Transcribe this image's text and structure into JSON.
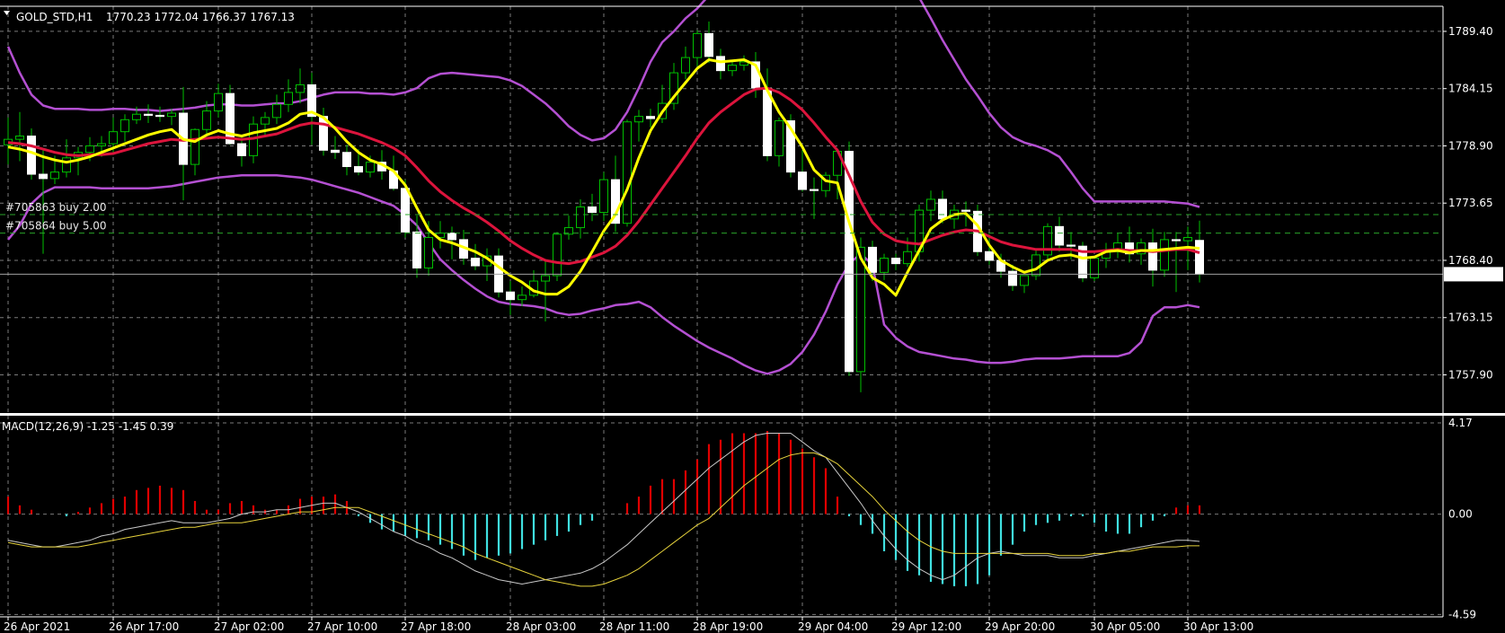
{
  "window": {
    "symbol_header": "GOLD_STD,H1",
    "ohlc_header": "1770.23 1772.04 1766.37 1767.13",
    "colors": {
      "background": "#000000",
      "grid": "#7a7a7a",
      "candle_bull": "#000000",
      "candle_bear": "#ffffff",
      "wick": "#00c000",
      "ma_fast": "#ffff00",
      "ma_slow": "#dc143c",
      "bollinger": "#b450d2",
      "histogram_pos": "#e00000",
      "histogram_neg": "#40e0e0",
      "macd_line": "#c8c8c8",
      "signal_line": "#e6d23c"
    }
  },
  "orders": [
    {
      "label": "#705863 buy 2.00",
      "price": 1772.6
    },
    {
      "label": "#705864 buy 5.00",
      "price": 1770.9
    }
  ],
  "current_price": {
    "label": "1767.13",
    "value": 1767.13
  },
  "price_axis": {
    "ticks": [
      "1789.40",
      "1784.15",
      "1778.90",
      "1773.65",
      "1768.40",
      "1763.15",
      "1757.90"
    ],
    "values": [
      1789.4,
      1784.15,
      1778.9,
      1773.65,
      1768.4,
      1763.15,
      1757.9
    ],
    "range": [
      1754.4,
      1791.7
    ]
  },
  "time_axis": {
    "labels": [
      "26 Apr 2021",
      "26 Apr 17:00",
      "27 Apr 02:00",
      "27 Apr 10:00",
      "27 Apr 18:00",
      "28 Apr 03:00",
      "28 Apr 11:00",
      "28 Apr 19:00",
      "29 Apr 04:00",
      "29 Apr 12:00",
      "29 Apr 20:00",
      "30 Apr 05:00",
      "30 Apr 13:00"
    ],
    "bar_index": [
      0,
      9,
      18,
      26,
      34,
      43,
      51,
      59,
      68,
      76,
      84,
      93,
      101
    ]
  },
  "macd": {
    "title": "MACD(12,26,9) -1.25 -1.45 0.39",
    "ticks": [
      "4.17",
      "0.00",
      "-4.59"
    ],
    "tick_values": [
      4.17,
      0,
      -4.59
    ],
    "range": [
      -4.7,
      4.5
    ]
  },
  "chart_data": {
    "type": "candlestick",
    "title": "GOLD_STD,H1",
    "bars": 103,
    "ohlc": [
      [
        1779.0,
        1781.5,
        1777.2,
        1779.5
      ],
      [
        1779.5,
        1782.0,
        1777.5,
        1779.8
      ],
      [
        1779.8,
        1780.5,
        1775.8,
        1776.3
      ],
      [
        1776.3,
        1778.5,
        1769.0,
        1775.9
      ],
      [
        1775.9,
        1778.0,
        1775.4,
        1776.5
      ],
      [
        1776.5,
        1779.5,
        1776.0,
        1777.8
      ],
      [
        1777.8,
        1778.8,
        1776.2,
        1778.3
      ],
      [
        1778.3,
        1779.7,
        1777.5,
        1778.9
      ],
      [
        1778.9,
        1779.8,
        1777.9,
        1779.1
      ],
      [
        1779.1,
        1781.5,
        1778.3,
        1780.2
      ],
      [
        1780.2,
        1781.8,
        1779.3,
        1781.3
      ],
      [
        1781.3,
        1782.5,
        1780.9,
        1781.8
      ],
      [
        1781.8,
        1782.7,
        1781.0,
        1781.7
      ],
      [
        1781.7,
        1782.5,
        1781.1,
        1781.6
      ],
      [
        1781.6,
        1782.3,
        1780.8,
        1781.9
      ],
      [
        1781.9,
        1784.3,
        1773.9,
        1777.2
      ],
      [
        1777.2,
        1780.5,
        1776.2,
        1780.4
      ],
      [
        1780.4,
        1783.0,
        1780.0,
        1782.1
      ],
      [
        1782.1,
        1784.6,
        1781.5,
        1783.7
      ],
      [
        1783.7,
        1784.5,
        1779.0,
        1779.1
      ],
      [
        1779.1,
        1779.8,
        1777.0,
        1778.0
      ],
      [
        1778.0,
        1781.6,
        1777.3,
        1780.9
      ],
      [
        1780.9,
        1782.0,
        1779.8,
        1781.5
      ],
      [
        1781.5,
        1783.6,
        1780.9,
        1782.7
      ],
      [
        1782.7,
        1785.0,
        1782.0,
        1783.8
      ],
      [
        1783.8,
        1786.0,
        1782.8,
        1784.5
      ],
      [
        1784.5,
        1785.6,
        1779.0,
        1781.6
      ],
      [
        1781.6,
        1782.4,
        1778.0,
        1778.5
      ],
      [
        1778.5,
        1779.8,
        1777.7,
        1778.3
      ],
      [
        1778.3,
        1779.0,
        1776.2,
        1777.0
      ],
      [
        1777.0,
        1778.6,
        1776.2,
        1776.5
      ],
      [
        1776.5,
        1778.0,
        1776.0,
        1777.4
      ],
      [
        1777.4,
        1778.5,
        1775.8,
        1776.6
      ],
      [
        1776.6,
        1778.0,
        1774.8,
        1775.0
      ],
      [
        1775.0,
        1775.8,
        1770.5,
        1771.0
      ],
      [
        1771.0,
        1772.5,
        1766.8,
        1767.7
      ],
      [
        1767.7,
        1772.0,
        1767.0,
        1770.5
      ],
      [
        1770.5,
        1772.0,
        1769.5,
        1770.9
      ],
      [
        1770.9,
        1771.5,
        1768.5,
        1770.3
      ],
      [
        1770.3,
        1771.2,
        1768.0,
        1768.6
      ],
      [
        1768.6,
        1769.9,
        1767.5,
        1767.9
      ],
      [
        1767.9,
        1769.5,
        1766.5,
        1768.8
      ],
      [
        1768.8,
        1769.5,
        1765.0,
        1765.5
      ],
      [
        1765.5,
        1766.5,
        1763.4,
        1764.8
      ],
      [
        1764.8,
        1766.0,
        1764.2,
        1765.2
      ],
      [
        1765.2,
        1767.5,
        1765.0,
        1766.5
      ],
      [
        1766.5,
        1768.5,
        1762.8,
        1767.0
      ],
      [
        1767.0,
        1771.0,
        1766.5,
        1770.8
      ],
      [
        1770.8,
        1772.5,
        1770.3,
        1771.4
      ],
      [
        1771.4,
        1774.0,
        1770.4,
        1773.3
      ],
      [
        1773.3,
        1774.5,
        1772.0,
        1772.8
      ],
      [
        1772.8,
        1776.5,
        1772.0,
        1775.8
      ],
      [
        1775.8,
        1778.0,
        1771.0,
        1771.8
      ],
      [
        1771.8,
        1781.3,
        1771.5,
        1781.1
      ],
      [
        1781.1,
        1782.2,
        1779.3,
        1781.6
      ],
      [
        1781.6,
        1782.3,
        1780.6,
        1781.4
      ],
      [
        1781.4,
        1784.5,
        1781.0,
        1782.8
      ],
      [
        1782.8,
        1786.5,
        1782.2,
        1785.6
      ],
      [
        1785.6,
        1788.0,
        1785.0,
        1787.0
      ],
      [
        1787.0,
        1789.5,
        1786.2,
        1789.2
      ],
      [
        1789.2,
        1790.3,
        1786.5,
        1787.1
      ],
      [
        1787.1,
        1787.8,
        1785.0,
        1785.8
      ],
      [
        1785.8,
        1786.8,
        1785.3,
        1786.3
      ],
      [
        1786.3,
        1787.2,
        1785.8,
        1786.6
      ],
      [
        1786.6,
        1787.5,
        1783.3,
        1784.2
      ],
      [
        1784.2,
        1786.0,
        1777.5,
        1778.0
      ],
      [
        1778.0,
        1781.5,
        1777.0,
        1781.2
      ],
      [
        1781.2,
        1781.8,
        1776.0,
        1776.5
      ],
      [
        1776.5,
        1778.5,
        1774.7,
        1774.9
      ],
      [
        1774.9,
        1776.0,
        1772.2,
        1774.8
      ],
      [
        1774.8,
        1776.5,
        1774.2,
        1776.2
      ],
      [
        1776.2,
        1778.0,
        1774.0,
        1778.4
      ],
      [
        1778.4,
        1779.3,
        1757.8,
        1758.2
      ],
      [
        1758.2,
        1770.5,
        1756.3,
        1769.6
      ],
      [
        1769.6,
        1770.2,
        1766.5,
        1767.3
      ],
      [
        1767.3,
        1769.0,
        1766.6,
        1768.6
      ],
      [
        1768.6,
        1769.0,
        1767.5,
        1768.1
      ],
      [
        1768.1,
        1770.5,
        1767.8,
        1769.2
      ],
      [
        1769.2,
        1773.5,
        1768.3,
        1773.0
      ],
      [
        1773.0,
        1774.8,
        1772.0,
        1774.0
      ],
      [
        1774.0,
        1774.8,
        1771.8,
        1772.2
      ],
      [
        1772.2,
        1773.5,
        1771.3,
        1773.0
      ],
      [
        1773.0,
        1773.8,
        1771.5,
        1772.9
      ],
      [
        1772.9,
        1773.5,
        1768.8,
        1769.2
      ],
      [
        1769.2,
        1770.8,
        1768.0,
        1768.4
      ],
      [
        1768.4,
        1769.0,
        1766.8,
        1767.4
      ],
      [
        1767.4,
        1768.0,
        1765.6,
        1766.1
      ],
      [
        1766.1,
        1767.0,
        1765.4,
        1767.0
      ],
      [
        1767.0,
        1769.5,
        1766.6,
        1768.9
      ],
      [
        1768.9,
        1771.8,
        1768.4,
        1771.5
      ],
      [
        1771.5,
        1772.4,
        1769.2,
        1769.8
      ],
      [
        1769.8,
        1771.0,
        1768.5,
        1769.7
      ],
      [
        1769.7,
        1770.1,
        1766.4,
        1766.8
      ],
      [
        1766.8,
        1768.7,
        1766.5,
        1768.6
      ],
      [
        1768.6,
        1770.0,
        1767.7,
        1769.2
      ],
      [
        1769.2,
        1770.9,
        1768.6,
        1770.0
      ],
      [
        1770.0,
        1771.5,
        1768.2,
        1769.0
      ],
      [
        1769.0,
        1770.4,
        1768.0,
        1770.0
      ],
      [
        1770.0,
        1771.3,
        1766.0,
        1767.5
      ],
      [
        1767.5,
        1771.0,
        1766.9,
        1770.3
      ],
      [
        1770.3,
        1771.0,
        1765.5,
        1770.2
      ],
      [
        1770.2,
        1771.5,
        1767.5,
        1770.5
      ],
      [
        1770.23,
        1772.04,
        1766.37,
        1767.13
      ]
    ],
    "ma_fast": [
      1778.8,
      1778.6,
      1778.3,
      1777.9,
      1777.6,
      1777.4,
      1777.6,
      1777.9,
      1778.3,
      1778.7,
      1779.1,
      1779.5,
      1779.9,
      1780.2,
      1780.4,
      1779.5,
      1779.3,
      1779.9,
      1780.3,
      1780.0,
      1779.8,
      1780.1,
      1780.3,
      1780.5,
      1781.0,
      1781.8,
      1782.0,
      1781.5,
      1780.5,
      1779.3,
      1778.3,
      1777.6,
      1777.2,
      1776.6,
      1775.3,
      1773.2,
      1771.2,
      1770.3,
      1770.0,
      1769.6,
      1769.2,
      1768.6,
      1767.8,
      1767.0,
      1766.4,
      1765.6,
      1765.3,
      1765.3,
      1766.0,
      1767.4,
      1769.2,
      1771.1,
      1772.6,
      1774.9,
      1777.8,
      1780.3,
      1782.0,
      1783.4,
      1784.7,
      1786.0,
      1786.8,
      1786.6,
      1786.7,
      1786.8,
      1786.3,
      1784.0,
      1782.0,
      1780.5,
      1778.8,
      1776.7,
      1775.7,
      1775.5,
      1771.9,
      1768.6,
      1766.8,
      1766.2,
      1765.2,
      1767.3,
      1769.3,
      1771.3,
      1772.1,
      1772.6,
      1772.7,
      1771.6,
      1769.8,
      1768.4,
      1767.8,
      1767.3,
      1767.6,
      1768.4,
      1768.8,
      1768.9,
      1768.6,
      1768.7,
      1769.2,
      1769.3,
      1769.1,
      1769.3,
      1769.3,
      1769.4,
      1769.5,
      1769.6,
      1769.5
    ],
    "ma_slow": [
      1779.2,
      1779.1,
      1778.9,
      1778.6,
      1778.3,
      1778.1,
      1778.0,
      1778.1,
      1778.1,
      1778.2,
      1778.5,
      1778.8,
      1779.1,
      1779.3,
      1779.5,
      1779.4,
      1779.5,
      1779.6,
      1779.7,
      1779.6,
      1779.5,
      1779.6,
      1779.8,
      1780.0,
      1780.4,
      1780.8,
      1781.0,
      1780.9,
      1780.6,
      1780.3,
      1780.0,
      1779.6,
      1779.2,
      1778.7,
      1778.0,
      1776.9,
      1775.7,
      1774.7,
      1773.9,
      1773.2,
      1772.6,
      1771.9,
      1771.1,
      1770.2,
      1769.5,
      1768.9,
      1768.4,
      1768.2,
      1768.1,
      1768.3,
      1768.7,
      1769.1,
      1769.7,
      1770.7,
      1772.0,
      1773.5,
      1775.0,
      1776.5,
      1778.0,
      1779.6,
      1781.0,
      1782.0,
      1782.8,
      1783.6,
      1784.1,
      1784.2,
      1783.8,
      1783.1,
      1782.2,
      1781.0,
      1779.7,
      1778.5,
      1776.2,
      1773.8,
      1771.9,
      1770.8,
      1770.2,
      1770.0,
      1769.9,
      1770.3,
      1770.7,
      1771.0,
      1771.2,
      1771.1,
      1770.6,
      1770.1,
      1769.8,
      1769.6,
      1769.4,
      1769.4,
      1769.4,
      1769.4,
      1769.2,
      1769.2,
      1769.3,
      1769.4,
      1769.3,
      1769.3,
      1769.2,
      1769.3,
      1769.4,
      1769.4,
      1769.1
    ],
    "bb_upper": [
      1788.0,
      1785.6,
      1783.6,
      1782.6,
      1782.3,
      1782.3,
      1782.3,
      1782.2,
      1782.2,
      1782.3,
      1782.3,
      1782.2,
      1782.2,
      1782.1,
      1782.2,
      1782.3,
      1782.4,
      1782.6,
      1782.7,
      1782.7,
      1782.6,
      1782.6,
      1782.7,
      1782.8,
      1782.8,
      1783.0,
      1783.3,
      1783.6,
      1783.8,
      1783.8,
      1783.8,
      1783.7,
      1783.7,
      1783.6,
      1783.8,
      1784.2,
      1785.1,
      1785.5,
      1785.6,
      1785.5,
      1785.4,
      1785.3,
      1785.2,
      1784.9,
      1784.4,
      1783.6,
      1782.8,
      1781.8,
      1780.7,
      1779.9,
      1779.4,
      1779.6,
      1780.4,
      1782.0,
      1784.2,
      1786.6,
      1788.4,
      1789.4,
      1790.6,
      1791.5,
      1792.7,
      1793.9,
      1795.1,
      1795.9,
      1796.3,
      1796.5,
      1796.4,
      1796.0,
      1795.2,
      1794.5,
      1794.1,
      1794.2,
      1796.1,
      1797.4,
      1797.3,
      1796.6,
      1795.6,
      1794.2,
      1792.5,
      1790.6,
      1788.6,
      1786.8,
      1785.0,
      1783.5,
      1781.9,
      1780.6,
      1779.7,
      1779.2,
      1778.9,
      1778.5,
      1777.9,
      1776.5,
      1775.0,
      1773.8,
      1773.8,
      1773.8,
      1773.8,
      1773.8,
      1773.8,
      1773.8,
      1773.7,
      1773.6,
      1773.3
    ],
    "bb_lower": [
      1770.3,
      1771.6,
      1773.6,
      1774.6,
      1775.1,
      1775.1,
      1775.1,
      1775.1,
      1775.0,
      1775.0,
      1775.0,
      1775.0,
      1775.0,
      1775.1,
      1775.2,
      1775.4,
      1775.6,
      1775.8,
      1776.0,
      1776.1,
      1776.2,
      1776.2,
      1776.2,
      1776.2,
      1776.1,
      1776.0,
      1775.8,
      1775.5,
      1775.2,
      1774.9,
      1774.6,
      1774.2,
      1773.8,
      1773.4,
      1772.6,
      1771.6,
      1770.0,
      1768.5,
      1767.5,
      1766.6,
      1765.8,
      1765.1,
      1764.6,
      1764.4,
      1764.3,
      1764.2,
      1764.0,
      1763.6,
      1763.4,
      1763.5,
      1763.8,
      1764.0,
      1764.3,
      1764.4,
      1764.6,
      1764.1,
      1763.2,
      1762.4,
      1761.7,
      1761.0,
      1760.4,
      1759.9,
      1759.4,
      1758.8,
      1758.3,
      1758.0,
      1758.3,
      1758.9,
      1760.0,
      1761.6,
      1763.7,
      1766.2,
      1768.1,
      1769.0,
      1768.0,
      1762.5,
      1761.3,
      1760.5,
      1760.0,
      1759.8,
      1759.6,
      1759.4,
      1759.3,
      1759.1,
      1759.0,
      1759.0,
      1759.1,
      1759.3,
      1759.4,
      1759.4,
      1759.4,
      1759.5,
      1759.6,
      1759.6,
      1759.6,
      1759.6,
      1759.9,
      1760.9,
      1763.3,
      1764.1,
      1764.1,
      1764.3,
      1764.1
    ],
    "macd_hist": [
      0.8,
      0.4,
      0.2,
      0.0,
      0.0,
      -0.1,
      0.1,
      0.3,
      0.5,
      0.7,
      0.8,
      1.1,
      1.2,
      1.3,
      1.2,
      1.1,
      0.6,
      0.2,
      0.2,
      0.5,
      0.6,
      0.4,
      0.2,
      0.2,
      0.4,
      0.7,
      0.8,
      0.8,
      0.9,
      0.6,
      -0.1,
      -0.4,
      -0.7,
      -0.8,
      -1.0,
      -1.1,
      -1.2,
      -1.4,
      -1.6,
      -1.9,
      -2.1,
      -2.0,
      -1.9,
      -1.8,
      -1.6,
      -1.4,
      -1.2,
      -1.0,
      -0.8,
      -0.5,
      -0.3,
      0.0,
      0.0,
      0.5,
      0.8,
      1.3,
      1.6,
      1.6,
      2.0,
      2.5,
      3.2,
      3.4,
      3.7,
      3.7,
      3.7,
      3.8,
      3.7,
      3.4,
      3.0,
      2.6,
      2.1,
      0.8,
      -0.1,
      -0.5,
      -0.9,
      -1.7,
      -2.1,
      -2.6,
      -2.8,
      -3.1,
      -3.2,
      -3.3,
      -3.3,
      -3.2,
      -2.8,
      -1.9,
      -1.4,
      -0.8,
      -0.5,
      -0.4,
      -0.3,
      -0.1,
      -0.1,
      -0.4,
      -0.8,
      -0.9,
      -0.9,
      -0.6,
      -0.3,
      -0.1,
      0.3,
      0.4,
      0.4
    ],
    "macd_line": [
      -1.2,
      -1.3,
      -1.4,
      -1.5,
      -1.5,
      -1.4,
      -1.3,
      -1.2,
      -1.0,
      -0.9,
      -0.7,
      -0.6,
      -0.5,
      -0.4,
      -0.3,
      -0.4,
      -0.4,
      -0.4,
      -0.3,
      -0.2,
      0.0,
      0.1,
      0.1,
      0.2,
      0.2,
      0.3,
      0.4,
      0.5,
      0.5,
      0.3,
      0.1,
      -0.2,
      -0.5,
      -0.8,
      -1.0,
      -1.3,
      -1.5,
      -1.8,
      -2.0,
      -2.3,
      -2.6,
      -2.8,
      -3.0,
      -3.1,
      -3.2,
      -3.1,
      -3.0,
      -2.9,
      -2.8,
      -2.7,
      -2.5,
      -2.2,
      -1.8,
      -1.4,
      -0.9,
      -0.4,
      0.1,
      0.6,
      1.1,
      1.6,
      2.1,
      2.5,
      2.9,
      3.3,
      3.6,
      3.7,
      3.7,
      3.7,
      3.3,
      2.9,
      2.6,
      1.9,
      1.2,
      0.5,
      -0.3,
      -1.0,
      -1.6,
      -2.1,
      -2.5,
      -2.8,
      -3.0,
      -2.8,
      -2.4,
      -2.0,
      -1.8,
      -1.7,
      -1.8,
      -1.9,
      -1.9,
      -1.9,
      -2.0,
      -2.0,
      -2.0,
      -1.9,
      -1.8,
      -1.7,
      -1.6,
      -1.5,
      -1.4,
      -1.3,
      -1.2,
      -1.2,
      -1.25
    ],
    "signal_line": [
      -1.3,
      -1.4,
      -1.5,
      -1.5,
      -1.5,
      -1.5,
      -1.5,
      -1.4,
      -1.3,
      -1.2,
      -1.1,
      -1.0,
      -0.9,
      -0.8,
      -0.7,
      -0.6,
      -0.6,
      -0.5,
      -0.4,
      -0.4,
      -0.4,
      -0.3,
      -0.2,
      -0.1,
      0.0,
      0.1,
      0.1,
      0.2,
      0.3,
      0.3,
      0.3,
      0.1,
      -0.1,
      -0.3,
      -0.5,
      -0.7,
      -0.9,
      -1.1,
      -1.3,
      -1.5,
      -1.8,
      -2.0,
      -2.2,
      -2.4,
      -2.6,
      -2.8,
      -3.0,
      -3.1,
      -3.2,
      -3.3,
      -3.3,
      -3.2,
      -3.0,
      -2.8,
      -2.5,
      -2.1,
      -1.7,
      -1.3,
      -0.9,
      -0.5,
      -0.2,
      0.3,
      0.8,
      1.3,
      1.7,
      2.1,
      2.5,
      2.7,
      2.8,
      2.8,
      2.6,
      2.3,
      1.8,
      1.3,
      0.8,
      0.2,
      -0.3,
      -0.8,
      -1.2,
      -1.5,
      -1.7,
      -1.8,
      -1.8,
      -1.8,
      -1.8,
      -1.8,
      -1.8,
      -1.8,
      -1.8,
      -1.8,
      -1.9,
      -1.9,
      -1.9,
      -1.8,
      -1.8,
      -1.7,
      -1.7,
      -1.6,
      -1.5,
      -1.5,
      -1.5,
      -1.45,
      -1.45
    ]
  }
}
